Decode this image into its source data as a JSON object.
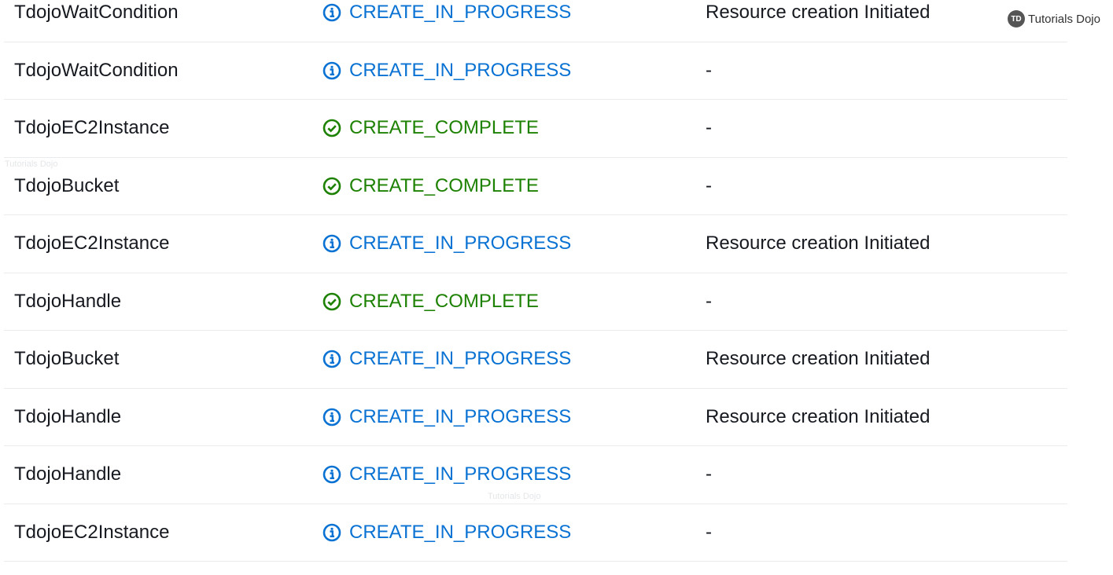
{
  "colors": {
    "in_progress": "#0972d3",
    "complete": "#1d8102",
    "text": "#16191f"
  },
  "events": [
    {
      "logical_id": "TdojoWaitCondition",
      "status": "CREATE_IN_PROGRESS",
      "status_type": "in_progress",
      "icon": "info-circle-icon",
      "reason": "Resource creation Initiated"
    },
    {
      "logical_id": "TdojoWaitCondition",
      "status": "CREATE_IN_PROGRESS",
      "status_type": "in_progress",
      "icon": "info-circle-icon",
      "reason": "-"
    },
    {
      "logical_id": "TdojoEC2Instance",
      "status": "CREATE_COMPLETE",
      "status_type": "complete",
      "icon": "check-circle-icon",
      "reason": "-"
    },
    {
      "logical_id": "TdojoBucket",
      "status": "CREATE_COMPLETE",
      "status_type": "complete",
      "icon": "check-circle-icon",
      "reason": "-"
    },
    {
      "logical_id": "TdojoEC2Instance",
      "status": "CREATE_IN_PROGRESS",
      "status_type": "in_progress",
      "icon": "info-circle-icon",
      "reason": "Resource creation Initiated"
    },
    {
      "logical_id": "TdojoHandle",
      "status": "CREATE_COMPLETE",
      "status_type": "complete",
      "icon": "check-circle-icon",
      "reason": "-"
    },
    {
      "logical_id": "TdojoBucket",
      "status": "CREATE_IN_PROGRESS",
      "status_type": "in_progress",
      "icon": "info-circle-icon",
      "reason": "Resource creation Initiated"
    },
    {
      "logical_id": "TdojoHandle",
      "status": "CREATE_IN_PROGRESS",
      "status_type": "in_progress",
      "icon": "info-circle-icon",
      "reason": "Resource creation Initiated"
    },
    {
      "logical_id": "TdojoHandle",
      "status": "CREATE_IN_PROGRESS",
      "status_type": "in_progress",
      "icon": "info-circle-icon",
      "reason": "-"
    },
    {
      "logical_id": "TdojoEC2Instance",
      "status": "CREATE_IN_PROGRESS",
      "status_type": "in_progress",
      "icon": "info-circle-icon",
      "reason": "-"
    }
  ],
  "watermark": {
    "logo_badge": "TD",
    "logo_text": "Tutorials Dojo",
    "faint_text": "Tutorials Dojo"
  }
}
